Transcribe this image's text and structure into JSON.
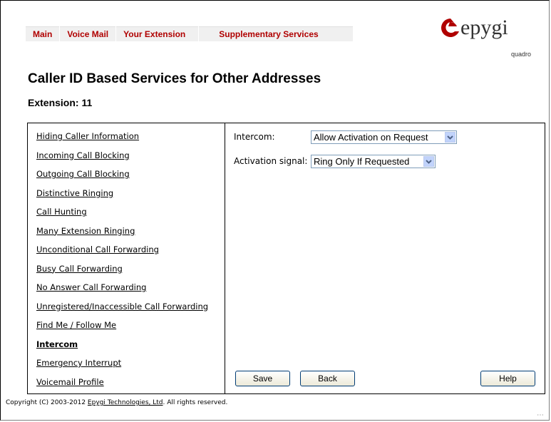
{
  "nav": [
    {
      "label": "Main"
    },
    {
      "label": "Voice Mail"
    },
    {
      "label": "Your Extension"
    },
    {
      "label": "Supplementary Services"
    }
  ],
  "logo": {
    "word": "epygi",
    "sub": "quadro",
    "color": "#b00000"
  },
  "page": {
    "title": "Caller ID Based Services for Other Addresses",
    "extension": "Extension: 11"
  },
  "menu": [
    {
      "label": "Hiding Caller Information"
    },
    {
      "label": "Incoming Call Blocking"
    },
    {
      "label": "Outgoing Call Blocking"
    },
    {
      "label": "Distinctive Ringing"
    },
    {
      "label": "Call Hunting"
    },
    {
      "label": "Many Extension Ringing"
    },
    {
      "label": "Unconditional Call Forwarding"
    },
    {
      "label": "Busy Call Forwarding"
    },
    {
      "label": "No Answer Call Forwarding"
    },
    {
      "label": "Unregistered/Inaccessible Call Forwarding"
    },
    {
      "label": "Find Me / Follow Me"
    },
    {
      "label": "Intercom",
      "active": true
    },
    {
      "label": "Emergency Interrupt"
    },
    {
      "label": "Voicemail Profile"
    }
  ],
  "form": {
    "intercom_label": "Intercom:",
    "intercom_value": "Allow Activation on Request",
    "signal_label": "Activation signal:",
    "signal_value": "Ring Only If Requested"
  },
  "buttons": {
    "save": "Save",
    "back": "Back",
    "help": "Help"
  },
  "footer": {
    "prefix": "Copyright (C) 2003-2012 ",
    "link": "Epygi Technologies, Ltd",
    "suffix": ". All rights reserved."
  }
}
